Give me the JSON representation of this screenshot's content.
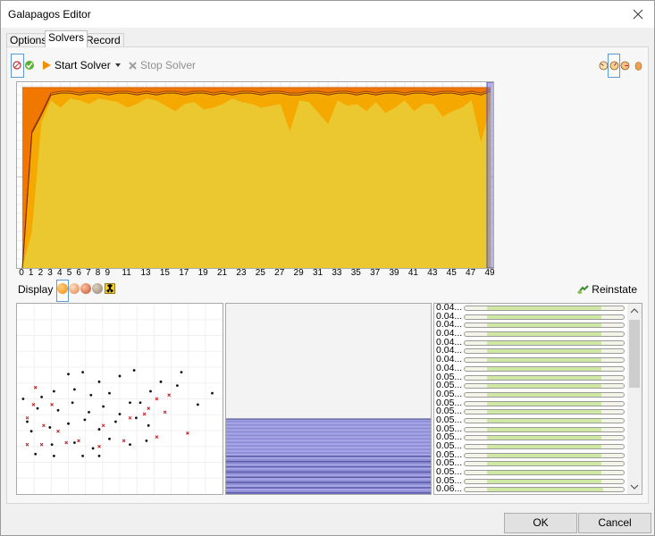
{
  "window": {
    "title": "Galapagos Editor"
  },
  "tabs": [
    {
      "label": "Options",
      "active": false
    },
    {
      "label": "Solvers",
      "active": true
    },
    {
      "label": "Record",
      "active": false
    }
  ],
  "toolbar": {
    "start_label": "Start Solver",
    "stop_label": "Stop Solver",
    "icons": [
      "gene-pool-icon",
      "check-icon",
      "play-icon",
      "dropdown-arrow-icon",
      "stop-icon",
      "rotation-left-icon",
      "rotation-mid-icon",
      "rotation-right-icon",
      "egg-icon"
    ]
  },
  "chart_data": {
    "type": "area",
    "x_ticks": [
      "0",
      "1",
      "2",
      "3",
      "4",
      "5",
      "6",
      "7",
      "8",
      "9",
      "11",
      "13",
      "15",
      "17",
      "19",
      "21",
      "23",
      "25",
      "27",
      "29",
      "31",
      "33",
      "35",
      "37",
      "39",
      "41",
      "43",
      "45",
      "47",
      "49"
    ],
    "x": [
      0,
      1,
      2,
      3,
      4,
      5,
      6,
      7,
      8,
      9,
      10,
      11,
      12,
      13,
      14,
      15,
      16,
      17,
      18,
      19,
      20,
      21,
      22,
      23,
      24,
      25,
      26,
      27,
      28,
      29,
      30,
      31,
      32,
      33,
      34,
      35,
      36,
      37,
      38,
      39,
      40,
      41,
      42,
      43,
      44,
      45,
      46,
      47,
      48,
      49
    ],
    "series": [
      {
        "values": [
          0.99,
          0.99,
          0.99,
          0.99,
          0.99,
          0.99,
          0.99,
          0.99,
          0.99,
          0.99,
          0.99,
          0.99,
          0.99,
          0.99,
          0.99,
          0.99,
          0.99,
          0.99,
          0.99,
          0.99,
          0.99,
          0.99,
          0.99,
          0.99,
          0.99,
          0.99,
          0.99,
          0.99,
          0.99,
          0.99,
          0.99,
          0.99,
          0.99,
          0.99,
          0.99,
          0.99,
          0.99,
          0.99,
          0.99,
          0.99,
          0.99,
          0.99,
          0.99,
          0.99,
          0.99,
          0.99,
          0.99,
          0.99,
          0.99,
          0.99
        ]
      },
      {
        "values": [
          0.0,
          0.75,
          0.85,
          0.96,
          0.97,
          0.97,
          0.96,
          0.97,
          0.97,
          0.96,
          0.97,
          0.97,
          0.96,
          0.97,
          0.96,
          0.97,
          0.97,
          0.96,
          0.97,
          0.97,
          0.96,
          0.97,
          0.96,
          0.97,
          0.97,
          0.96,
          0.97,
          0.97,
          0.96,
          0.96,
          0.97,
          0.97,
          0.96,
          0.97,
          0.97,
          0.96,
          0.97,
          0.96,
          0.97,
          0.97,
          0.96,
          0.97,
          0.97,
          0.96,
          0.97,
          0.97,
          0.96,
          0.97,
          0.96,
          0.98
        ]
      },
      {
        "values": [
          0.0,
          0.2,
          0.8,
          0.92,
          0.88,
          0.93,
          0.92,
          0.9,
          0.93,
          0.92,
          0.91,
          0.88,
          0.9,
          0.93,
          0.92,
          0.89,
          0.86,
          0.9,
          0.91,
          0.87,
          0.88,
          0.9,
          0.93,
          0.91,
          0.9,
          0.88,
          0.89,
          0.9,
          0.75,
          0.92,
          0.91,
          0.85,
          0.79,
          0.92,
          0.89,
          0.9,
          0.86,
          0.91,
          0.85,
          0.88,
          0.92,
          0.86,
          0.9,
          0.9,
          0.83,
          0.86,
          0.88,
          0.92,
          0.69,
          0.88
        ]
      }
    ],
    "highlight_index": 49,
    "ylim": [
      0,
      1
    ],
    "grid": true,
    "colors": [
      "#f07800",
      "#f5a800",
      "#ecc830"
    ]
  },
  "display": {
    "label": "Display",
    "swatches": [
      "#f08c00",
      "#f0a060",
      "#d86030",
      "#b0a090"
    ],
    "reinstate_label": "Reinstate"
  },
  "scatter": {
    "black": [
      [
        0.25,
        0.37
      ],
      [
        0.32,
        0.36
      ],
      [
        0.4,
        0.41
      ],
      [
        0.5,
        0.38
      ],
      [
        0.57,
        0.35
      ],
      [
        0.7,
        0.41
      ],
      [
        0.8,
        0.36
      ],
      [
        0.03,
        0.5
      ],
      [
        0.12,
        0.49
      ],
      [
        0.18,
        0.46
      ],
      [
        0.28,
        0.45
      ],
      [
        0.36,
        0.48
      ],
      [
        0.45,
        0.47
      ],
      [
        0.55,
        0.52
      ],
      [
        0.65,
        0.46
      ],
      [
        0.78,
        0.43
      ],
      [
        0.05,
        0.62
      ],
      [
        0.1,
        0.55
      ],
      [
        0.2,
        0.56
      ],
      [
        0.27,
        0.52
      ],
      [
        0.35,
        0.57
      ],
      [
        0.42,
        0.54
      ],
      [
        0.5,
        0.58
      ],
      [
        0.6,
        0.52
      ],
      [
        0.07,
        0.67
      ],
      [
        0.16,
        0.65
      ],
      [
        0.25,
        0.63
      ],
      [
        0.33,
        0.61
      ],
      [
        0.4,
        0.66
      ],
      [
        0.48,
        0.62
      ],
      [
        0.58,
        0.6
      ],
      [
        0.64,
        0.64
      ],
      [
        0.88,
        0.53
      ],
      [
        0.95,
        0.47
      ],
      [
        0.17,
        0.74
      ],
      [
        0.28,
        0.73
      ],
      [
        0.37,
        0.76
      ],
      [
        0.45,
        0.71
      ],
      [
        0.55,
        0.74
      ],
      [
        0.63,
        0.72
      ],
      [
        0.09,
        0.79
      ],
      [
        0.18,
        0.8
      ],
      [
        0.32,
        0.8
      ],
      [
        0.4,
        0.8
      ]
    ],
    "red": [
      [
        0.09,
        0.44
      ],
      [
        0.08,
        0.53
      ],
      [
        0.17,
        0.53
      ],
      [
        0.05,
        0.6
      ],
      [
        0.68,
        0.5
      ],
      [
        0.72,
        0.57
      ],
      [
        0.74,
        0.48
      ],
      [
        0.62,
        0.58
      ],
      [
        0.42,
        0.64
      ],
      [
        0.13,
        0.64
      ],
      [
        0.2,
        0.67
      ],
      [
        0.05,
        0.74
      ],
      [
        0.12,
        0.74
      ],
      [
        0.24,
        0.73
      ],
      [
        0.3,
        0.72
      ],
      [
        0.4,
        0.75
      ],
      [
        0.52,
        0.72
      ],
      [
        0.68,
        0.7
      ],
      [
        0.83,
        0.68
      ],
      [
        0.64,
        0.55
      ],
      [
        0.55,
        0.6
      ]
    ]
  },
  "histogram": {
    "bar_color": "#9d9de0",
    "values": [
      1,
      1,
      1,
      1,
      1,
      1,
      1,
      1,
      1,
      1,
      1,
      1,
      1,
      1,
      1,
      1,
      1,
      1,
      1,
      1,
      1,
      1,
      1,
      1,
      1,
      1,
      1,
      1,
      1,
      1,
      1,
      1,
      1,
      1,
      1,
      1,
      1,
      1,
      1,
      1,
      1,
      1,
      1
    ]
  },
  "genomes": {
    "rows": [
      {
        "label": "0.04...",
        "fill": 0.86
      },
      {
        "label": "0.04...",
        "fill": 0.86
      },
      {
        "label": "0.04...",
        "fill": 0.86
      },
      {
        "label": "0.04...",
        "fill": 0.86
      },
      {
        "label": "0.04...",
        "fill": 0.86
      },
      {
        "label": "0.04...",
        "fill": 0.86
      },
      {
        "label": "0.04...",
        "fill": 0.86
      },
      {
        "label": "0.04...",
        "fill": 0.86
      },
      {
        "label": "0.05...",
        "fill": 0.86
      },
      {
        "label": "0.05...",
        "fill": 0.86
      },
      {
        "label": "0.05...",
        "fill": 0.86
      },
      {
        "label": "0.05...",
        "fill": 0.86
      },
      {
        "label": "0.05...",
        "fill": 0.86
      },
      {
        "label": "0.05...",
        "fill": 0.86
      },
      {
        "label": "0.05...",
        "fill": 0.86
      },
      {
        "label": "0.05...",
        "fill": 0.86
      },
      {
        "label": "0.05...",
        "fill": 0.86
      },
      {
        "label": "0.05...",
        "fill": 0.86
      },
      {
        "label": "0.05...",
        "fill": 0.86
      },
      {
        "label": "0.05...",
        "fill": 0.86
      },
      {
        "label": "0.05...",
        "fill": 0.86
      },
      {
        "label": "0.06...",
        "fill": 0.87
      }
    ],
    "fill_color": "#cfe8a3"
  },
  "footer": {
    "ok_label": "OK",
    "cancel_label": "Cancel"
  }
}
